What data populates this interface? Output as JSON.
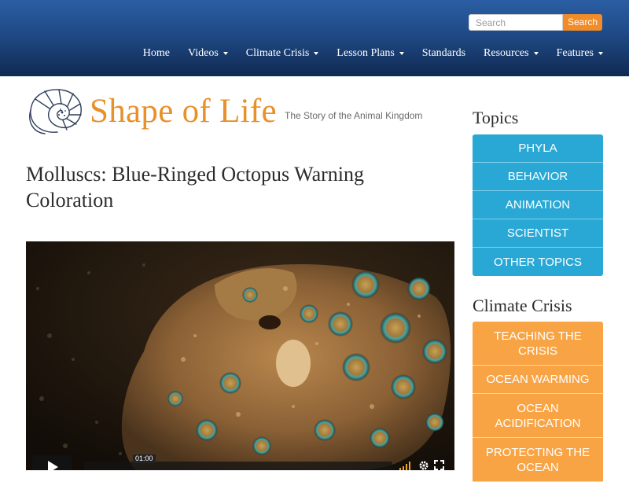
{
  "header": {
    "search_placeholder": "Search",
    "search_button": "Search",
    "nav": [
      {
        "label": "Home",
        "dropdown": false
      },
      {
        "label": "Videos",
        "dropdown": true
      },
      {
        "label": "Climate Crisis",
        "dropdown": true
      },
      {
        "label": "Lesson Plans",
        "dropdown": true
      },
      {
        "label": "Standards",
        "dropdown": false
      },
      {
        "label": "Resources",
        "dropdown": true
      },
      {
        "label": "Features",
        "dropdown": true
      }
    ]
  },
  "logo": {
    "title": "Shape of Life",
    "tagline": "The Story of the Animal Kingdom",
    "icon": "nautilus-shell-icon"
  },
  "article": {
    "title": "Molluscs: Blue-Ringed Octopus Warning Coloration",
    "video": {
      "time_tooltip": "01:00",
      "icons": [
        "play-icon",
        "volume-icon",
        "gear-icon",
        "fullscreen-icon"
      ]
    }
  },
  "sidebar": {
    "topics_heading": "Topics",
    "topics": [
      "PHYLA",
      "BEHAVIOR",
      "ANIMATION",
      "SCIENTIST",
      "OTHER TOPICS"
    ],
    "climate_heading": "Climate Crisis",
    "climate": [
      "TEACHING THE CRISIS",
      "OCEAN WARMING",
      "OCEAN ACIDIFICATION",
      "PROTECTING THE OCEAN"
    ]
  },
  "colors": {
    "header_top": "#2b5ea4",
    "header_bottom": "#102a52",
    "search_button": "#f28c28",
    "logo_orange": "#e8912a",
    "topics_blue": "#29a8d6",
    "climate_orange": "#f9a444"
  }
}
